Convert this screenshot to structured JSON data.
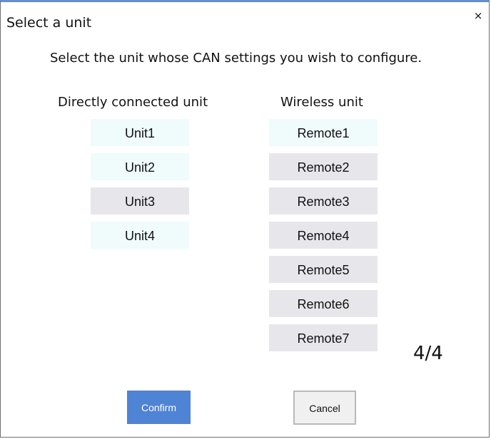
{
  "dialog": {
    "title": "Select a unit",
    "close_icon": "×",
    "instruction": "Select the unit whose CAN settings you wish to configure.",
    "direct_header": "Directly connected unit",
    "wireless_header": "Wireless unit",
    "direct_units": [
      "Unit1",
      "Unit2",
      "Unit3",
      "Unit4"
    ],
    "wireless_units": [
      "Remote1",
      "Remote2",
      "Remote3",
      "Remote4",
      "Remote5",
      "Remote6",
      "Remote7"
    ],
    "page_indicator": "4/4",
    "confirm_label": "Confirm",
    "cancel_label": "Cancel"
  },
  "colors": {
    "title_bar_accent": "#5f8fd9",
    "confirm_background": "#4f83d5",
    "available_item_background": "#f0fbfb",
    "unavailable_item_background": "#e7e7eb",
    "cancel_border": "#b9b9b9"
  }
}
